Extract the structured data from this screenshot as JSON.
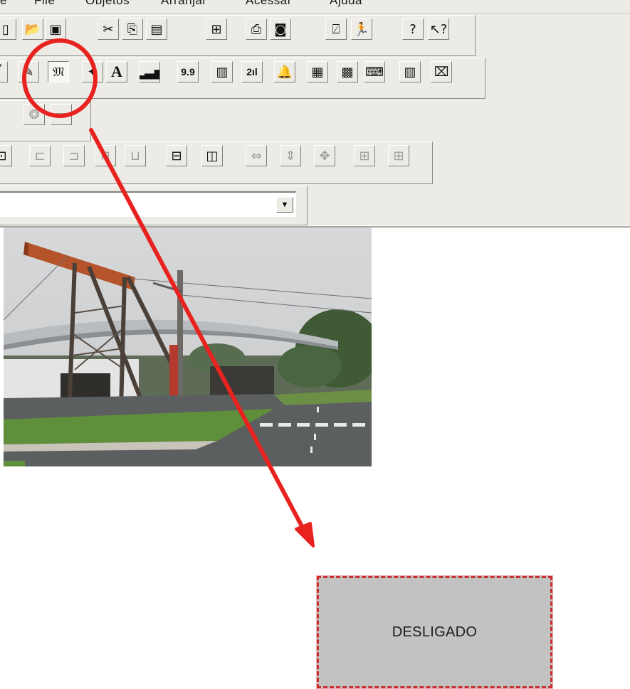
{
  "menu": [
    {
      "id": "first",
      "label": "e"
    },
    {
      "id": "file",
      "label": "File"
    },
    {
      "id": "objects",
      "label": "Objetos"
    },
    {
      "id": "arrange",
      "label": "Arranjar"
    },
    {
      "id": "interface",
      "label": "Acessar"
    },
    {
      "id": "help",
      "label": "Ajuda"
    }
  ],
  "toolbar_row1": {
    "buttons": [
      {
        "name": "new-icon",
        "glyph": "▯"
      },
      {
        "name": "open-folder-icon",
        "glyph": "📂"
      },
      {
        "name": "save-disk-icon",
        "glyph": "▣"
      },
      {
        "name": "cut-icon",
        "glyph": "✂"
      },
      {
        "name": "copy-icon",
        "glyph": "⎘"
      },
      {
        "name": "paste-icon",
        "glyph": "▤"
      },
      {
        "name": "tree-icon",
        "glyph": "⊞"
      },
      {
        "name": "properties-icon",
        "glyph": "⎙"
      },
      {
        "name": "camera-icon",
        "glyph": "◙"
      },
      {
        "name": "exit-run-icon",
        "glyph": "⍁"
      },
      {
        "name": "runner-icon",
        "glyph": "🏃"
      },
      {
        "name": "help-icon",
        "glyph": "?"
      },
      {
        "name": "context-help-icon",
        "glyph": "↖?"
      }
    ]
  },
  "toolbar_row2": {
    "buttons": [
      {
        "name": "line-icon",
        "glyph": "╱"
      },
      {
        "name": "pen-tool-icon",
        "glyph": "✎"
      },
      {
        "name": "symbol-tool-icon",
        "glyph": "𝔐",
        "pressed": true
      },
      {
        "name": "effects-icon",
        "glyph": "✦"
      },
      {
        "name": "text-tool-icon",
        "glyph": "A",
        "text": true
      },
      {
        "name": "bar-graph-icon",
        "glyph": "▂▃▅"
      },
      {
        "name": "numeric-display-icon",
        "glyph": "9.9",
        "small": true
      },
      {
        "name": "film-icon",
        "glyph": "▥"
      },
      {
        "name": "counter-icon",
        "glyph": "2ıl",
        "small": true
      },
      {
        "name": "alarm-bell-icon",
        "glyph": "🔔"
      },
      {
        "name": "calendar-icon",
        "glyph": "▦"
      },
      {
        "name": "picture-icon",
        "glyph": "▩"
      },
      {
        "name": "video-camera-icon",
        "glyph": "⌨"
      },
      {
        "name": "movie-icon",
        "glyph": "▥"
      },
      {
        "name": "camcorder-icon",
        "glyph": "⌧"
      }
    ]
  },
  "toolbar_row3": {
    "buttons": [
      {
        "name": "shutter-icon",
        "glyph": "❂",
        "dim": true
      },
      {
        "name": "grey-rect-icon",
        "glyph": "▬",
        "dim": true
      }
    ]
  },
  "toolbar_row4": {
    "buttons": [
      {
        "name": "align-icon",
        "glyph": "⊡"
      },
      {
        "name": "align-left-icon",
        "glyph": "⊏",
        "dim": true
      },
      {
        "name": "align-right-icon",
        "glyph": "⊐",
        "dim": true
      },
      {
        "name": "align-top-icon",
        "glyph": "⊓",
        "dim": true
      },
      {
        "name": "align-bottom-icon",
        "glyph": "⊔",
        "dim": true
      },
      {
        "name": "center-vertical-icon",
        "glyph": "⊟"
      },
      {
        "name": "center-horizontal-icon",
        "glyph": "◫"
      },
      {
        "name": "same-width-icon",
        "glyph": "⇔",
        "dim": true
      },
      {
        "name": "same-height-icon",
        "glyph": "⇕",
        "dim": true
      },
      {
        "name": "same-size-icon",
        "glyph": "✥",
        "dim": true
      },
      {
        "name": "distribute-h-icon",
        "glyph": "⊞",
        "dim": true
      },
      {
        "name": "distribute-v-icon",
        "glyph": "⊞",
        "dim": true
      }
    ]
  },
  "combo": {
    "value": "",
    "arrow": "▼"
  },
  "status_box": {
    "label": "DESLIGADO"
  },
  "colors": {
    "annotation_red": "#e8231f",
    "status_fill": "#c2c2c2",
    "status_border": "#c83030"
  }
}
